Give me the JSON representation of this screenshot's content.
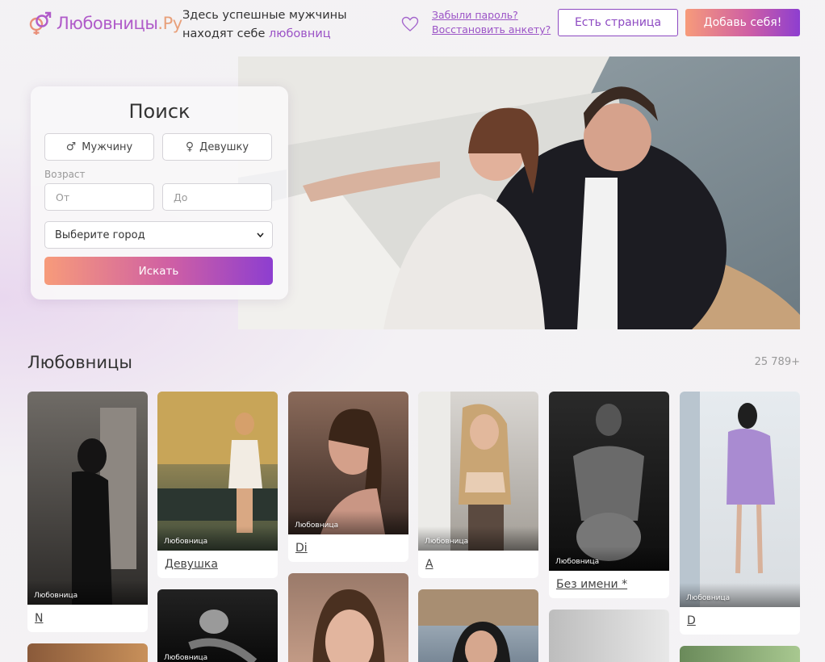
{
  "header": {
    "logo_text": "Любовницы",
    "logo_suffix": ".Ру",
    "tagline_main": "Здесь успешные мужчины находят себе",
    "tagline_accent": "любовниц",
    "forgot_password": "Забыли пароль?",
    "restore_profile": "Восстановить анкету?",
    "have_page_button": "Есть страница",
    "add_self_button": "Добавь себя!"
  },
  "search": {
    "title": "Поиск",
    "male_label": "Мужчину",
    "female_label": "Девушку",
    "age_label": "Возраст",
    "age_from_placeholder": "От",
    "age_to_placeholder": "До",
    "city_select": "Выберите город",
    "submit_label": "Искать"
  },
  "listing": {
    "title": "Любовницы",
    "count": "25 789+",
    "tag": "Любовница",
    "cards": [
      {
        "name": "N"
      },
      {
        "name": "Девушка"
      },
      {
        "name": "Di"
      },
      {
        "name": "A"
      },
      {
        "name": "Без имени *"
      },
      {
        "name": "D"
      }
    ]
  },
  "colors": {
    "accent": "#9b53c6",
    "gradient_start": "#f79b7a",
    "gradient_end": "#8d3ed0"
  }
}
